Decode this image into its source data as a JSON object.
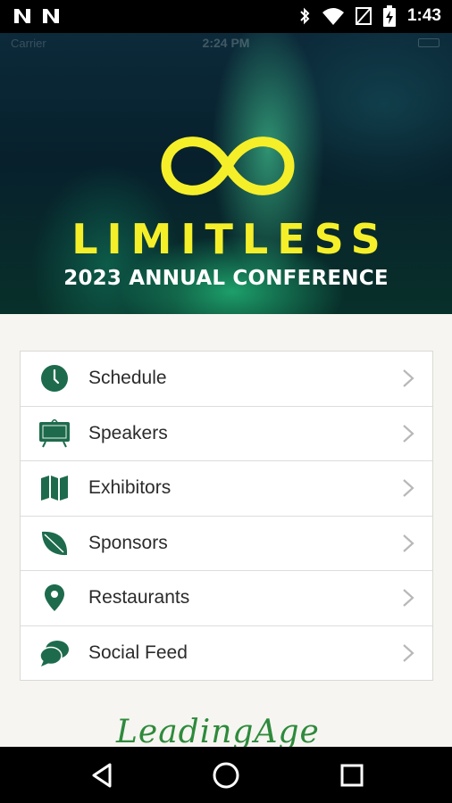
{
  "status_bar": {
    "time": "1:43",
    "icons": [
      "n-notification-icon",
      "n-notification-icon",
      "bluetooth-icon",
      "wifi-icon",
      "no-sim-icon",
      "battery-charging-icon"
    ]
  },
  "hero": {
    "ghost_status": {
      "carrier": "Carrier",
      "time": "2:24 PM"
    },
    "logo_icon": "infinity-icon",
    "title": "LIMITLESS",
    "subtitle": "2023 ANNUAL CONFERENCE"
  },
  "menu": {
    "items": [
      {
        "label": "Schedule",
        "icon": "clock-icon"
      },
      {
        "label": "Speakers",
        "icon": "presentation-board-icon"
      },
      {
        "label": "Exhibitors",
        "icon": "map-icon"
      },
      {
        "label": "Sponsors",
        "icon": "leaf-icon"
      },
      {
        "label": "Restaurants",
        "icon": "location-pin-icon"
      },
      {
        "label": "Social Feed",
        "icon": "chat-bubbles-icon"
      }
    ]
  },
  "footer": {
    "logo_text": "LeadingAge"
  },
  "colors": {
    "accent": "#1d6b4c",
    "title_yellow": "#f5ef2a",
    "chevron": "#b8b8b8"
  }
}
